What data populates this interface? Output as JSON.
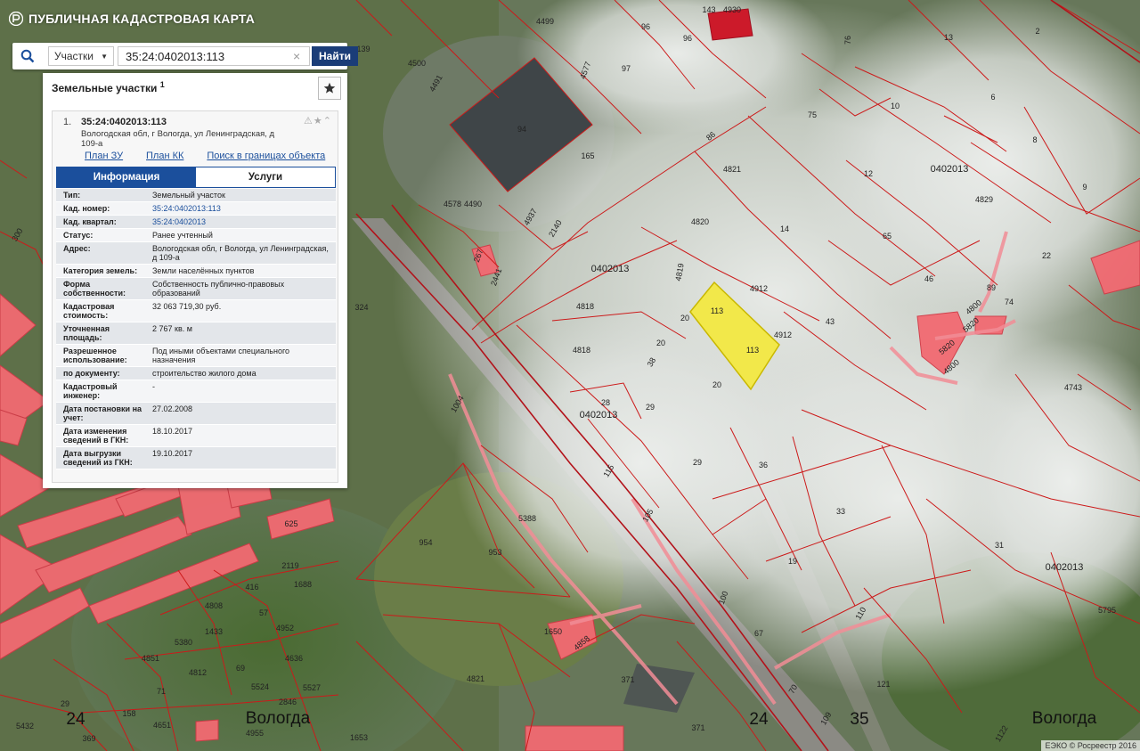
{
  "header": {
    "title": "ПУБЛИЧНАЯ КАДАСТРОВАЯ КАРТА"
  },
  "search": {
    "type_label": "Участки",
    "query": "35:24:0402013:113",
    "go_label": "Найти"
  },
  "panel": {
    "title": "Земельные участки",
    "count": "1",
    "item": {
      "index": "1.",
      "cadastral_number": "35:24:0402013:113",
      "address": "Вологодская обл, г Вологда, ул Ленинградская, д 109-а",
      "links": [
        "План ЗУ →",
        "План КК →",
        "Поиск в границах объекта →"
      ]
    },
    "tabs": [
      "Информация",
      "Услуги"
    ],
    "attributes": [
      {
        "k": "Тип:",
        "v": "Земельный участок"
      },
      {
        "k": "Кад. номер:",
        "v": "35:24:0402013:113",
        "link": true
      },
      {
        "k": "Кад. квартал:",
        "v": "35:24:0402013",
        "link": true
      },
      {
        "k": "Статус:",
        "v": "Ранее учтенный"
      },
      {
        "k": "Адрес:",
        "v": "Вологодская обл, г Вологда, ул Ленинградская, д 109-а"
      },
      {
        "k": "Категория земель:",
        "v": "Земли населённых пунктов"
      },
      {
        "k": "Форма собственности:",
        "v": "Собственность публично-правовых образований"
      },
      {
        "k": "Кадастровая стоимость:",
        "v": "32 063 719,30 руб."
      },
      {
        "k": "Уточненная площадь:",
        "v": "2 767 кв. м"
      },
      {
        "k": "Разрешенное использование:",
        "v": "Под иными объектами специального назначения"
      },
      {
        "k": "по документу:",
        "v": "строительство жилого дома"
      },
      {
        "k": "Кадастровый инженер:",
        "v": "-"
      },
      {
        "k": "Дата постановки на учет:",
        "v": "27.02.2008"
      },
      {
        "k": "Дата изменения сведений в ГКН:",
        "v": "18.10.2017"
      },
      {
        "k": "Дата выгрузки сведений из ГКН:",
        "v": "19.10.2017"
      }
    ]
  },
  "map": {
    "quarter_labels": [
      "0402013",
      "0402013",
      "0402013",
      "0402013"
    ],
    "city_labels": [
      "Вологда",
      "Вологда"
    ],
    "region_labels": [
      "24",
      "24",
      "35"
    ],
    "parcel_labels": [
      "96",
      "96",
      "143",
      "4930",
      "76",
      "13",
      "2",
      "4499",
      "4500",
      "97",
      "4577",
      "4491",
      "94",
      "165",
      "75",
      "10",
      "6",
      "8",
      "9",
      "86",
      "4821",
      "12",
      "4829",
      "4578",
      "4490",
      "4937",
      "2140",
      "4820",
      "14",
      "65",
      "300",
      "139",
      "22",
      "267",
      "2441",
      "4819",
      "4912",
      "46",
      "89",
      "74",
      "4800",
      "5820",
      "113",
      "113",
      "4818",
      "20",
      "4912",
      "43",
      "324",
      "4818",
      "20",
      "38",
      "28",
      "29",
      "4743",
      "1004",
      "20",
      "4800",
      "5820",
      "115",
      "36",
      "33",
      "5388",
      "954",
      "953",
      "105",
      "29",
      "19",
      "31",
      "100",
      "625",
      "2119",
      "1688",
      "416",
      "4808",
      "57",
      "1433",
      "4952",
      "5380",
      "4636",
      "4851",
      "4812",
      "69",
      "5524",
      "71",
      "2846",
      "5527",
      "29",
      "158",
      "4651",
      "4955",
      "5432",
      "369",
      "4821",
      "1650",
      "4858",
      "371",
      "371",
      "110",
      "67",
      "70",
      "121",
      "109",
      "1653",
      "5795",
      "1122"
    ],
    "colors": {
      "parcel_border": "#cc1a1a",
      "selected_fill": "#f2e84a",
      "building_fill": "#f26a72"
    }
  },
  "attribution": "ЕЭКО © Росреестр 2016"
}
